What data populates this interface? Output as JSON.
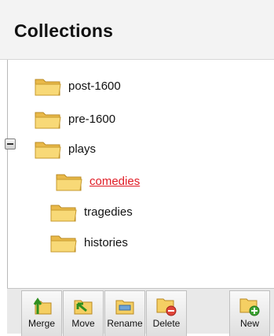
{
  "header": {
    "title": "Collections"
  },
  "tree": {
    "items": [
      {
        "label": "post-1600"
      },
      {
        "label": "pre-1600"
      },
      {
        "label": "plays"
      },
      {
        "label": "comedies"
      },
      {
        "label": "tragedies"
      },
      {
        "label": "histories"
      }
    ],
    "selected": "comedies"
  },
  "toolbar": {
    "buttons": [
      {
        "label": "Merge",
        "icon": "merge-icon"
      },
      {
        "label": "Move",
        "icon": "move-icon"
      },
      {
        "label": "Rename",
        "icon": "rename-icon"
      },
      {
        "label": "Delete",
        "icon": "delete-icon"
      },
      {
        "label": "New",
        "icon": "new-folder-icon"
      }
    ]
  },
  "colors": {
    "selected_text": "#e01b24",
    "folder": "#f5cf63",
    "header_bg": "#f3f3f3"
  }
}
